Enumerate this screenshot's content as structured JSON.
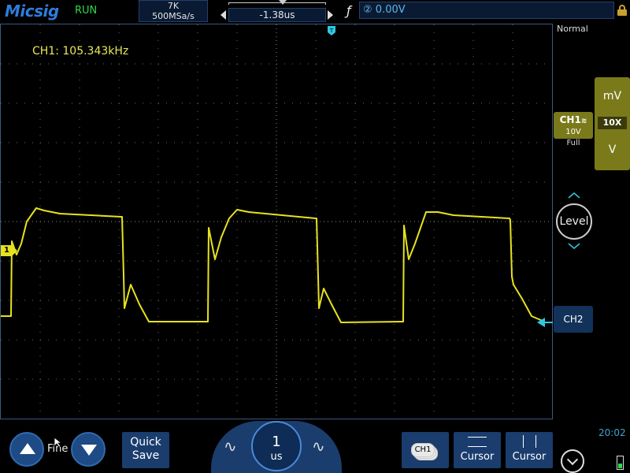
{
  "brand": {
    "logo": "Micsig",
    "status": "RUN"
  },
  "acquisition": {
    "memory_depth": "7K",
    "sample_rate": "500MSa/s"
  },
  "timebase": {
    "offset": "-1.38us",
    "scale_value": "1",
    "scale_unit": "us"
  },
  "trigger": {
    "source_icon": "②",
    "level": "0.00V",
    "mode": "Normal"
  },
  "measurement": {
    "ch1_freq": "CH1: 105.343kHz"
  },
  "ch1": {
    "label": "CH1",
    "scale": "10V",
    "bandwidth": "Full",
    "marker": "1",
    "probe_unit_top": "mV",
    "probe_ratio": "10X",
    "probe_unit_bottom": "V"
  },
  "ch2": {
    "label": "CH2"
  },
  "trigger_panel": {
    "level_label": "Level"
  },
  "bottom": {
    "fine_label": "Fine",
    "quick_save_line1": "Quick",
    "quick_save_line2": "Save",
    "channel_stack_label": "CH1",
    "cursor_h_label": "Cursor",
    "cursor_v_label": "Cursor",
    "time": "20:02"
  },
  "colors": {
    "ch1": "#e6e21e",
    "ch2": "#2ec8e0",
    "accent": "#1e4a85",
    "grid": "#555555"
  }
}
